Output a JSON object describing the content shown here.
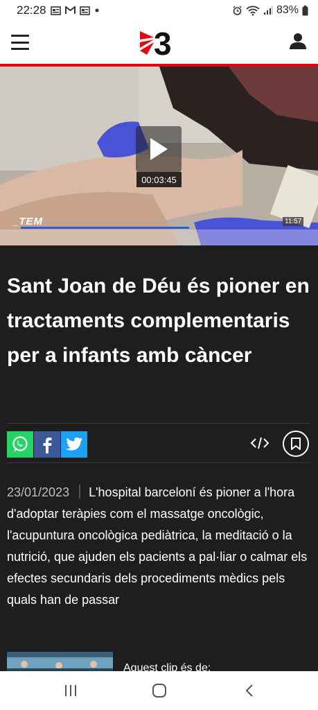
{
  "status_bar": {
    "time": "22:28",
    "battery": "83%"
  },
  "header": {
    "logo_text": "3",
    "menu_icon": "hamburger-menu-icon",
    "user_icon": "user-profile-icon"
  },
  "video": {
    "duration": "00:03:45",
    "channel_logo": "_TEM",
    "overlay_time": "11:57",
    "progress_fraction": 0.53
  },
  "article": {
    "title": "Sant Joan de Déu és pioner en tractaments complementaris per a infants amb càncer",
    "date": "23/01/2023",
    "summary": "L'hospital barceloní és pioner a l'hora d'adoptar teràpies com el massatge oncològic, l'acupuntura oncològica pediàtrica, la meditació o la nutrició, que ajuden els pacients a pal·liar o calmar els efectes secundaris dels procediments mèdics pels quals han de passar"
  },
  "share": {
    "whatsapp_color": "#25d366",
    "facebook_color": "#3b5998",
    "twitter_color": "#1da1f2"
  },
  "related": {
    "label": "Aquest clip és de:"
  },
  "colors": {
    "brand_red": "#e30613",
    "background": "#1e1e1e"
  }
}
